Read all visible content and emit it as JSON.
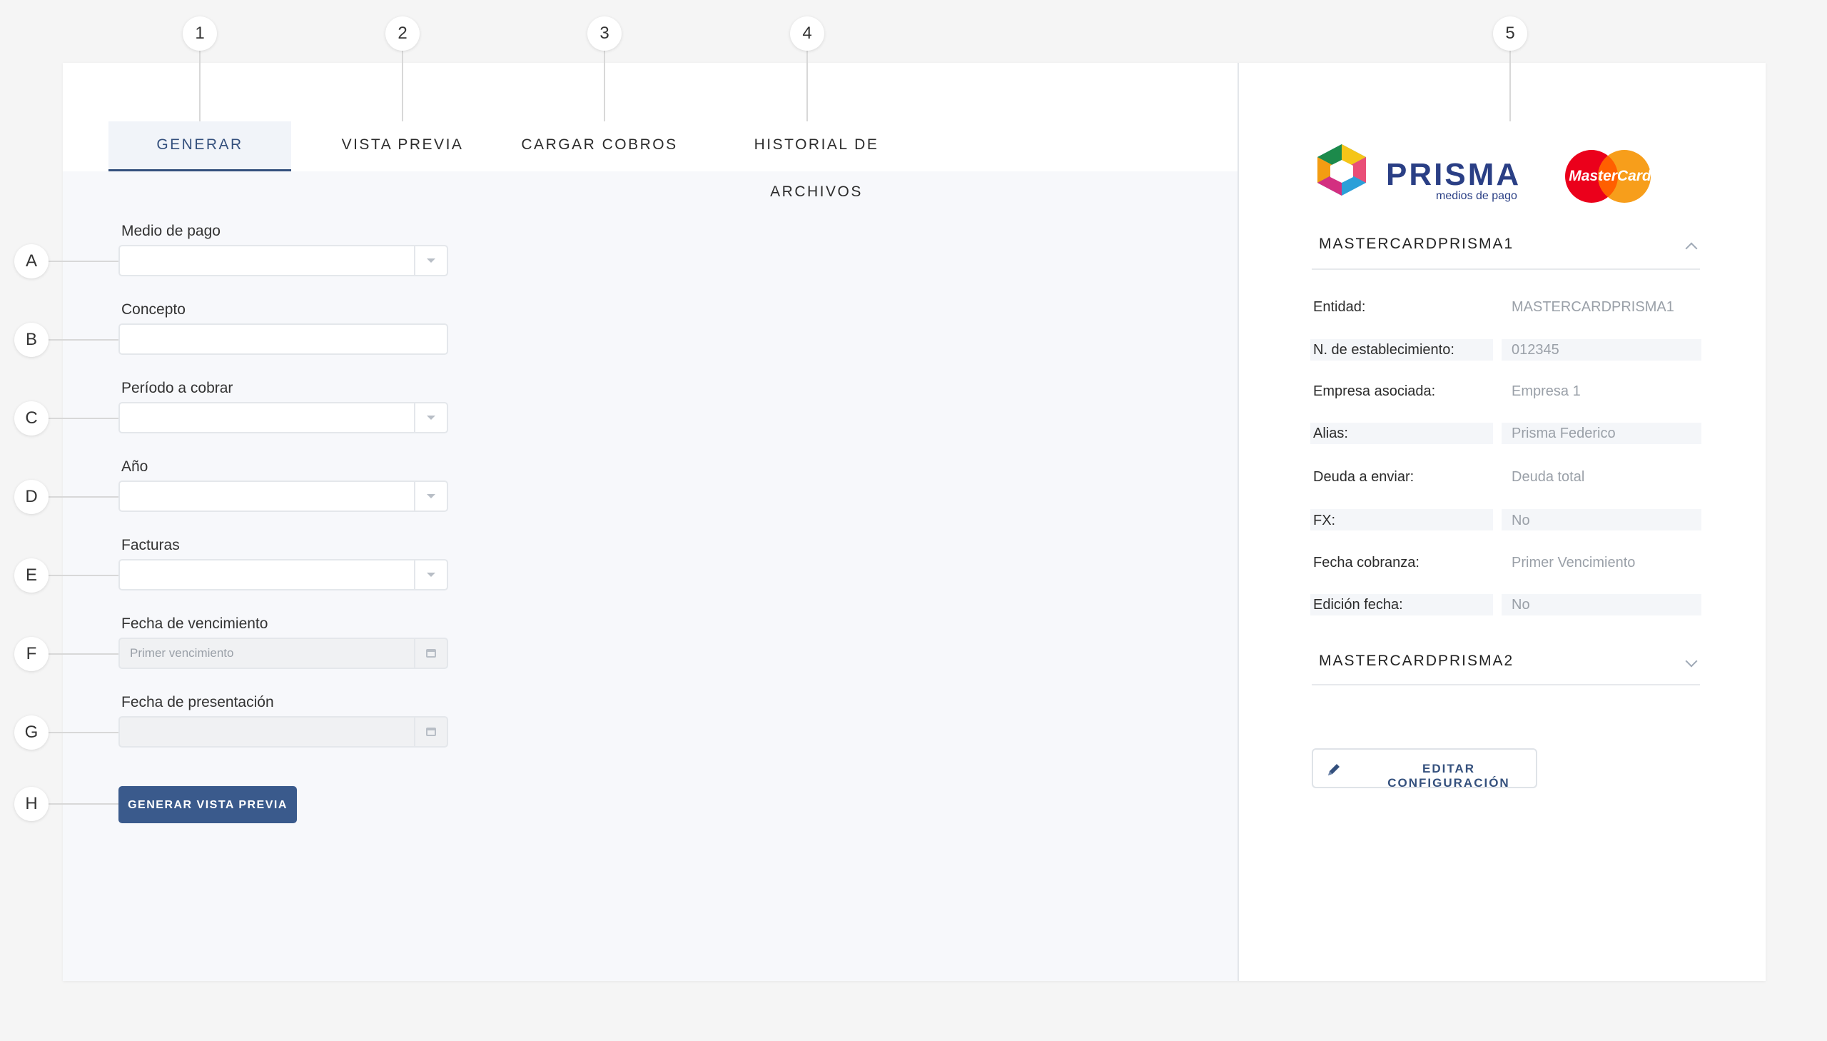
{
  "callouts_top": [
    "1",
    "2",
    "3",
    "4",
    "5"
  ],
  "callouts_left": [
    "A",
    "B",
    "C",
    "D",
    "E",
    "F",
    "G",
    "H"
  ],
  "tabs": [
    "GENERAR",
    "VISTA PREVIA",
    "CARGAR COBROS",
    "HISTORIAL DE ARCHIVOS"
  ],
  "form": {
    "medio_label": "Medio de pago",
    "concepto_label": "Concepto",
    "periodo_label": "Período a cobrar",
    "anio_label": "Año",
    "facturas_label": "Facturas",
    "fecha_venc_label": "Fecha de vencimiento",
    "fecha_venc_placeholder": "Primer vencimiento",
    "fecha_pres_label": "Fecha de presentación",
    "generate_button": "GENERAR VISTA PREVIA"
  },
  "logos": {
    "prisma_name": "PRISMA",
    "prisma_tagline": "medios de pago",
    "mastercard_text": "MasterCard",
    "mastercard_red": "#eb001b",
    "mastercard_orange": "#f79e1b"
  },
  "accounts": [
    {
      "title": "MASTERCARDPRISMA1",
      "expanded": true,
      "details": [
        {
          "label": "Entidad:",
          "value": "MASTERCARDPRISMA1"
        },
        {
          "label": "N. de establecimiento:",
          "value": "012345"
        },
        {
          "label": "Empresa asociada:",
          "value": "Empresa 1"
        },
        {
          "label": "Alias:",
          "value": "Prisma Federico"
        },
        {
          "label": "Deuda a enviar:",
          "value": "Deuda total"
        },
        {
          "label": "FX:",
          "value": "No"
        },
        {
          "label": "Fecha cobranza:",
          "value": "Primer Vencimiento"
        },
        {
          "label": "Edición fecha:",
          "value": "No"
        }
      ]
    },
    {
      "title": "MASTERCARDPRISMA2",
      "expanded": false
    }
  ],
  "edit_button": "EDITAR CONFIGURACIÓN",
  "colors": {
    "primary": "#3a5a8c",
    "active_tab_bg": "#f1f4f9",
    "muted_text": "#9aa0a8"
  }
}
